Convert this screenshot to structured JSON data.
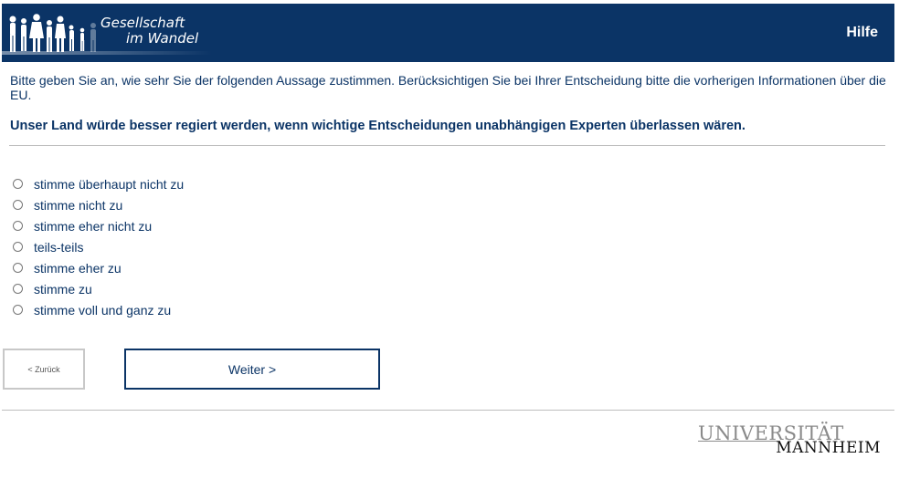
{
  "header": {
    "logo_line1": "Gesellschaft",
    "logo_line2": "im Wandel",
    "help_label": "Hilfe",
    "background_color": "#0b3466"
  },
  "question": {
    "instruction": "Bitte geben Sie an, wie sehr Sie der folgenden Aussage zustimmen. Berücksichtigen Sie bei Ihrer Entscheidung bitte die vorherigen Informationen über die EU.",
    "statement": "Unser Land würde besser regiert werden, wenn wichtige Entscheidungen unabhängigen Experten überlassen wären."
  },
  "options": [
    {
      "label": "stimme überhaupt nicht zu"
    },
    {
      "label": "stimme nicht zu"
    },
    {
      "label": "stimme eher nicht zu"
    },
    {
      "label": "teils-teils"
    },
    {
      "label": "stimme eher zu"
    },
    {
      "label": "stimme zu"
    },
    {
      "label": "stimme voll und ganz zu"
    }
  ],
  "navigation": {
    "back_label": "< Zurück",
    "next_label": "Weiter >"
  },
  "footer": {
    "uni_line1": "UNIVERSITÄT",
    "uni_line2": "MANNHEIM"
  }
}
